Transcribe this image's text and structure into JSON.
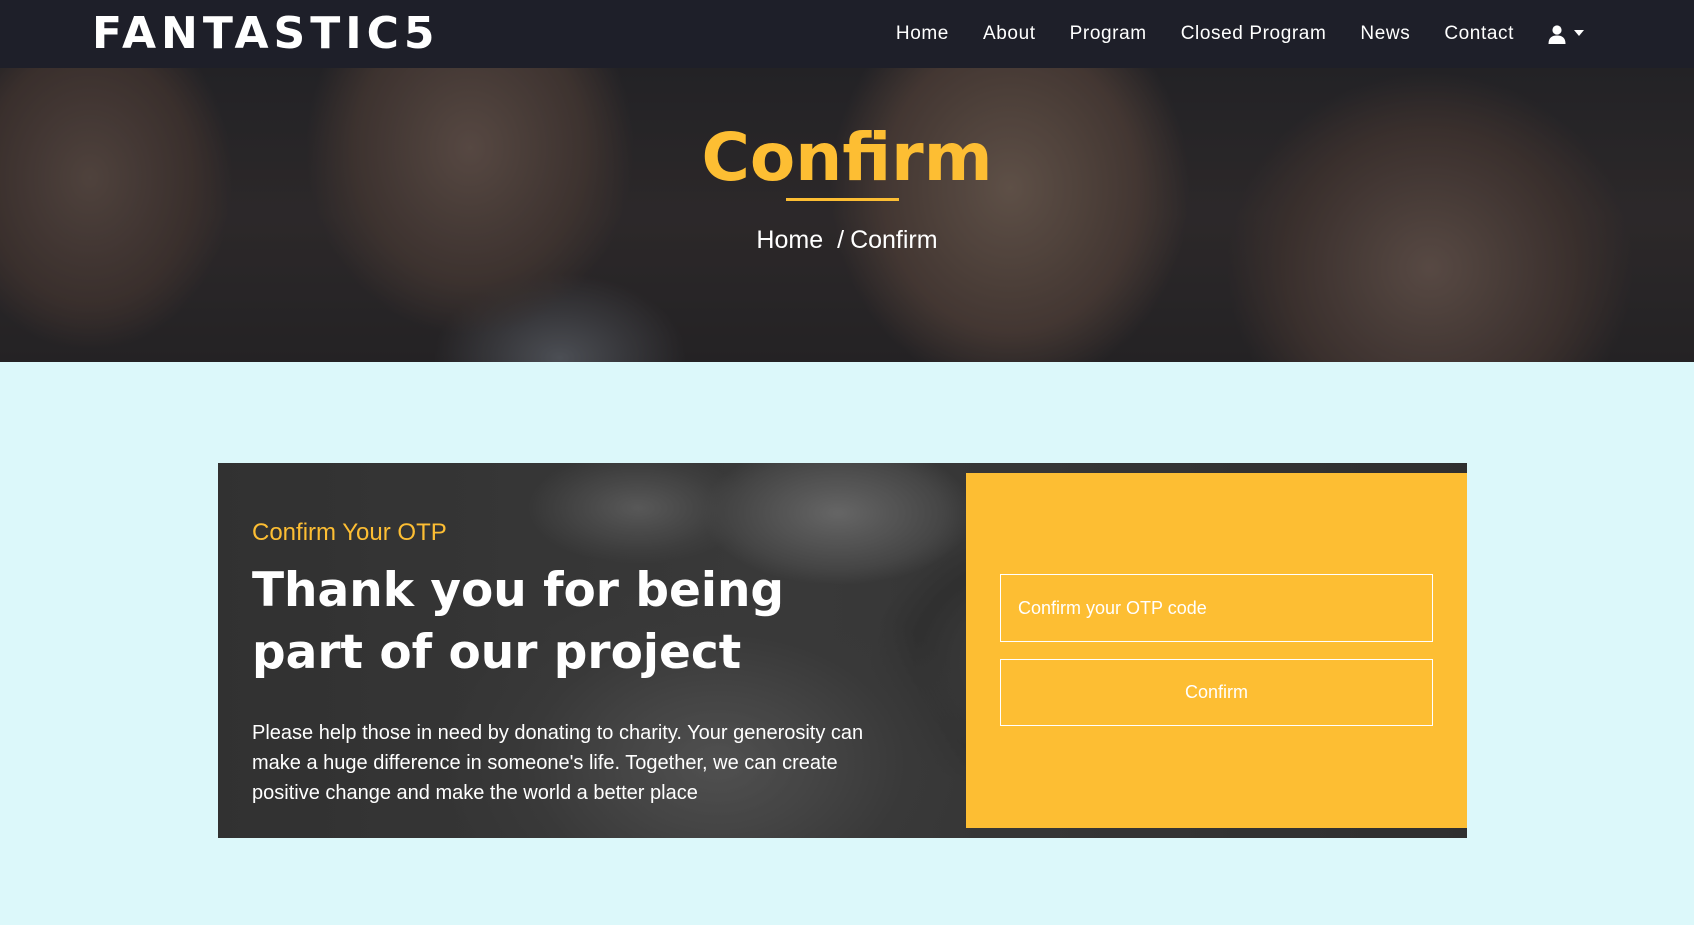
{
  "colors": {
    "navbar_bg": "#1e1f29",
    "accent": "#fdbe33",
    "page_bg": "#dcf8fa",
    "text_light": "#ffffff"
  },
  "navbar": {
    "brand": "FANTASTIC5",
    "links": [
      {
        "label": "Home"
      },
      {
        "label": "About"
      },
      {
        "label": "Program"
      },
      {
        "label": "Closed Program"
      },
      {
        "label": "News"
      },
      {
        "label": "Contact"
      }
    ],
    "user_menu": {
      "icon": "user-icon",
      "dropdown_icon": "caret-down-icon"
    }
  },
  "hero": {
    "title": "Confirm",
    "breadcrumb": {
      "home": "Home",
      "separator": "/",
      "current": "Confirm"
    }
  },
  "card": {
    "kicker": "Confirm Your OTP",
    "headline": "Thank you for being part of our project",
    "body": "Please help those in need by donating to charity. Your generosity can make a huge difference in someone's life. Together, we can create positive change and make the world a better place"
  },
  "form": {
    "otp_placeholder": "Confirm your OTP code",
    "otp_value": "",
    "submit_label": "Confirm"
  }
}
